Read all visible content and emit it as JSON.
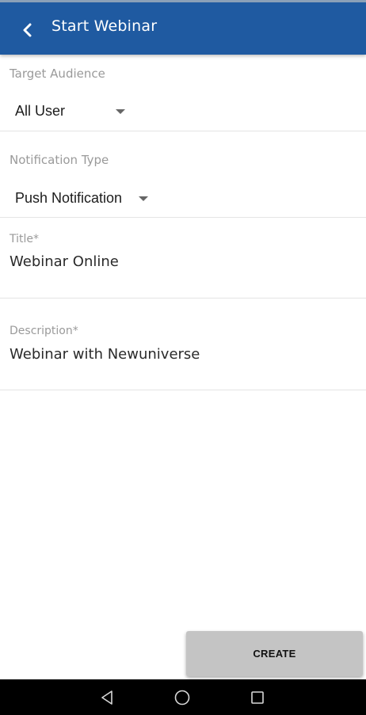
{
  "header": {
    "title": "Start Webinar",
    "background_color": "#1f5aa1",
    "back_icon": "chevron-left-icon"
  },
  "form": {
    "target_audience": {
      "label": "Target Audience",
      "value": "All User"
    },
    "notification_type": {
      "label": "Notification Type",
      "value": "Push Notification"
    },
    "title": {
      "label": "Title*",
      "value": "Webinar Online"
    },
    "description": {
      "label": "Description*",
      "value": "Webinar with Newuniverse"
    }
  },
  "actions": {
    "create_label": "CREATE"
  },
  "system_nav": {
    "back_icon": "triangle-back-icon",
    "home_icon": "circle-home-icon",
    "recents_icon": "square-recents-icon"
  }
}
